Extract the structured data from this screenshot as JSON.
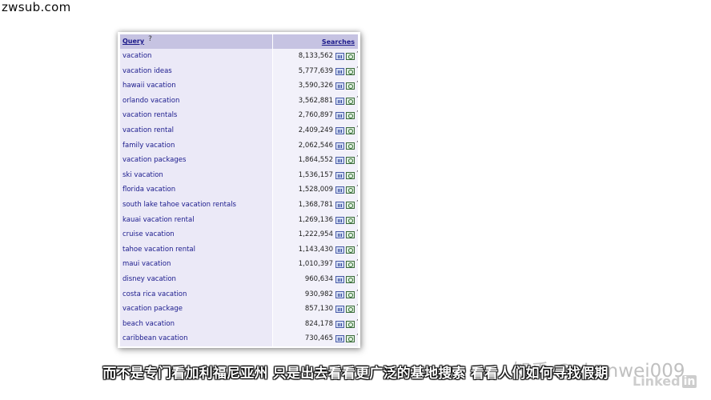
{
  "watermark": {
    "site": "zwsub.com",
    "zhihu": "知乎 @chenwei009"
  },
  "table": {
    "header": {
      "query": "Query",
      "help": "?",
      "searches": "Searches"
    },
    "rows": [
      {
        "query": "vacation",
        "searches": "8,133,562"
      },
      {
        "query": "vacation ideas",
        "searches": "5,777,639"
      },
      {
        "query": "hawaii vacation",
        "searches": "3,590,326"
      },
      {
        "query": "orlando vacation",
        "searches": "3,562,881"
      },
      {
        "query": "vacation rentals",
        "searches": "2,760,897"
      },
      {
        "query": "vacation rental",
        "searches": "2,409,249"
      },
      {
        "query": "family vacation",
        "searches": "2,062,546"
      },
      {
        "query": "vacation packages",
        "searches": "1,864,552"
      },
      {
        "query": "ski vacation",
        "searches": "1,536,157"
      },
      {
        "query": "florida vacation",
        "searches": "1,528,009"
      },
      {
        "query": "south lake tahoe vacation rentals",
        "searches": "1,368,781"
      },
      {
        "query": "kauai vacation rental",
        "searches": "1,269,136"
      },
      {
        "query": "cruise vacation",
        "searches": "1,222,954"
      },
      {
        "query": "tahoe vacation rental",
        "searches": "1,143,430"
      },
      {
        "query": "maui vacation",
        "searches": "1,010,397"
      },
      {
        "query": "disney vacation",
        "searches": "960,634"
      },
      {
        "query": "costa rica vacation",
        "searches": "930,982"
      },
      {
        "query": "vacation package",
        "searches": "857,130"
      },
      {
        "query": "beach vacation",
        "searches": "824,178"
      },
      {
        "query": "caribbean vacation",
        "searches": "730,465"
      }
    ],
    "icons": [
      "bar-chart-icon",
      "globe-icon"
    ]
  },
  "subtitle": "而不是专门看加利福尼亚州 只是出去看看更广泛的基地搜索 看看人们如何寻找假期",
  "brand": {
    "linkedin_text": "Linked",
    "linkedin_box": "in"
  }
}
